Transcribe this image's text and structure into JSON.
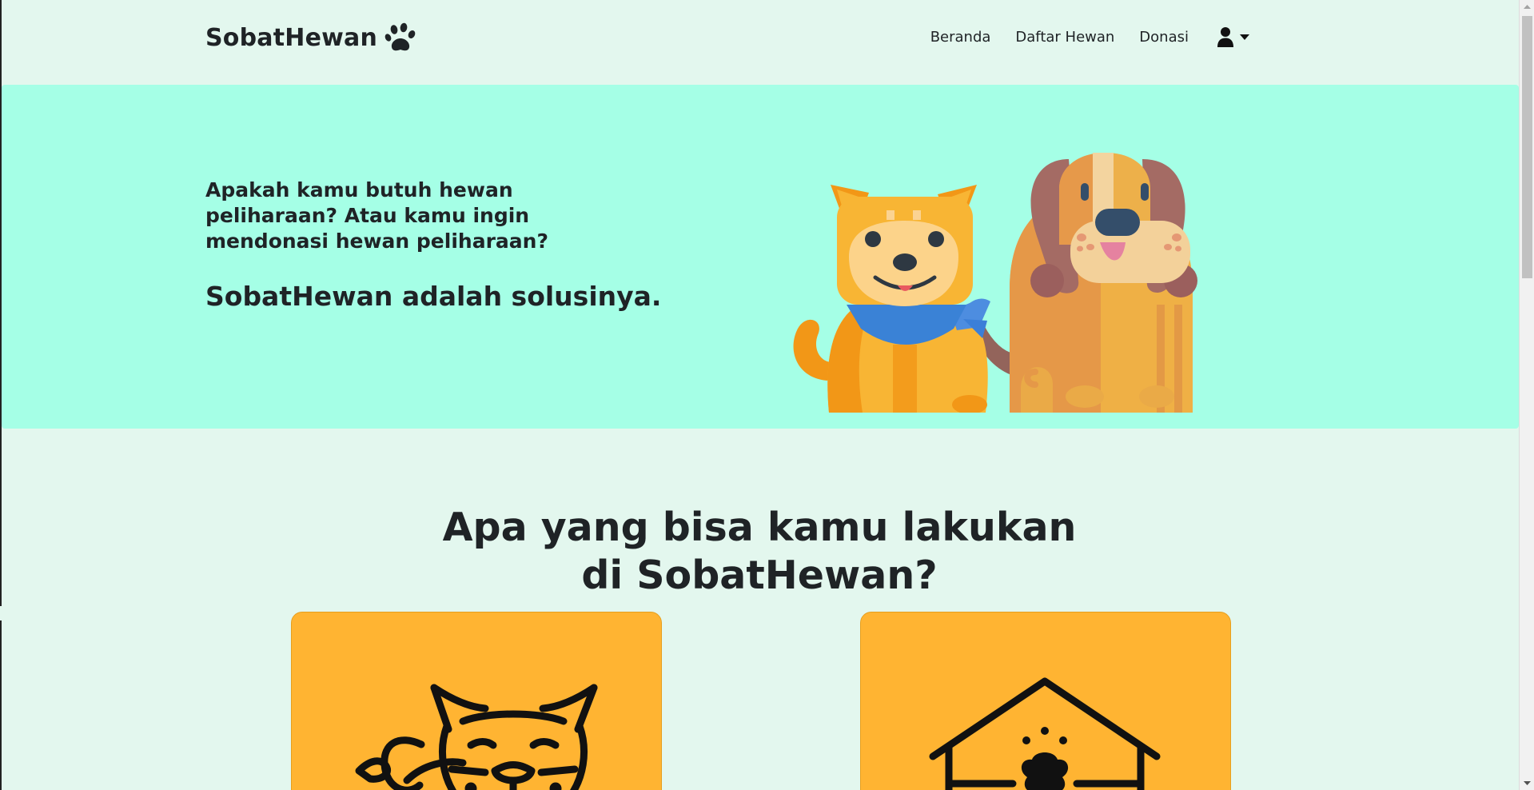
{
  "navbar": {
    "brand": "SobatHewan",
    "links": [
      "Beranda",
      "Daftar Hewan",
      "Donasi"
    ],
    "brand_icon": "paw-icon",
    "user_icon": "user-icon",
    "caret_icon": "caret-down-icon"
  },
  "hero": {
    "question": "Apakah kamu butuh hewan peliharaan? Atau kamu ingin mendonasi hewan peliharaan?",
    "answer": "SobatHewan adalah solusinya.",
    "illustration": "two-dogs-illustration",
    "background_color": "#a5ffe6"
  },
  "section": {
    "title_line1": "Apa yang bisa kamu lakukan",
    "title_line2": "di SobatHewan?",
    "cards": [
      {
        "icon": "cat-icon"
      },
      {
        "icon": "pet-house-icon"
      }
    ],
    "card_color": "#ffb432"
  },
  "theme": {
    "page_background": "#e3f7ee",
    "text_color": "#1f2326"
  }
}
